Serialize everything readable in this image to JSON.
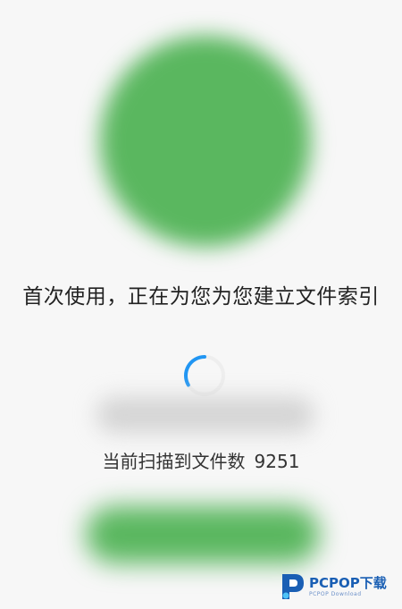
{
  "main": {
    "headline": "首次使用，正在为您为您建立文件索引",
    "scan_label": "当前扫描到文件数",
    "scan_count": "9251",
    "loading_icon": "loading-spinner-icon"
  },
  "watermark": {
    "brand": "PCPOP下载",
    "subtitle": "PCPOP Download"
  },
  "colors": {
    "accent_green": "#5ab75f",
    "spinner_blue": "#2196f3",
    "background": "#f7f7f7"
  }
}
